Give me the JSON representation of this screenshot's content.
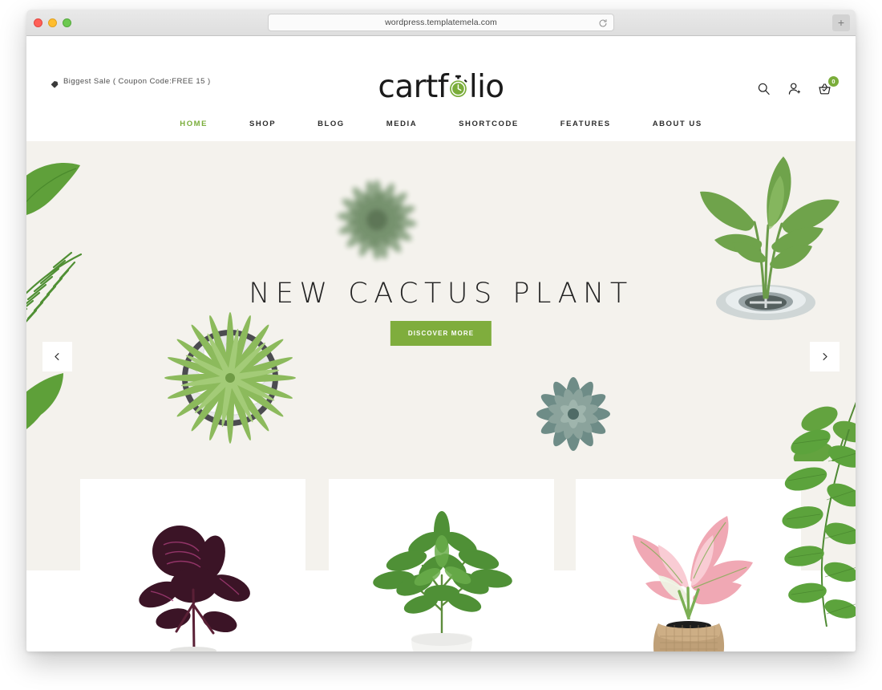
{
  "browser": {
    "url": "wordpress.templatemela.com",
    "reload_icon": "reload-icon",
    "new_tab_label": "+",
    "traffic_lights": [
      "close",
      "minimize",
      "maximize"
    ]
  },
  "header": {
    "promo": {
      "icon": "tag-icon",
      "text": "Biggest Sale ( Coupon Code:FREE 15 )"
    },
    "logo": {
      "text_before": "cartf",
      "mark": "stopwatch-icon",
      "text_after": "lio",
      "full_text": "cartfolio"
    },
    "icons": [
      {
        "name": "search-icon",
        "label": "Search"
      },
      {
        "name": "user-icon",
        "label": "My Account"
      },
      {
        "name": "cart-icon",
        "label": "Cart",
        "badge": "0"
      }
    ],
    "nav": [
      {
        "label": "HOME",
        "active": true
      },
      {
        "label": "SHOP",
        "active": false
      },
      {
        "label": "BLOG",
        "active": false
      },
      {
        "label": "MEDIA",
        "active": false
      },
      {
        "label": "SHORTCODE",
        "active": false
      },
      {
        "label": "FEATURES",
        "active": false
      },
      {
        "label": "ABOUT US",
        "active": false
      }
    ]
  },
  "hero": {
    "title": "NEW CACTUS PLANT",
    "cta_label": "DISCOVER MORE",
    "prev_arrow": "chevron-left-icon",
    "next_arrow": "chevron-right-icon",
    "background_color": "#f4f2ed",
    "decorations": [
      "blurred-agave-plant",
      "spiky-plant-in-stone-pot",
      "blue-grey-succulent",
      "plant-in-metal-drain",
      "leaf-left-edge",
      "fern-left-edge",
      "branch-right-edge"
    ]
  },
  "products": [
    {
      "name": "dark-purple-calathea-in-white-pot"
    },
    {
      "name": "green-schefflera-in-white-pot"
    },
    {
      "name": "pink-aglaonema-in-burlap-sack"
    }
  ],
  "colors": {
    "accent_green": "#7aad3a",
    "cta_green": "#7fad3d",
    "hero_cream": "#f4f2ed",
    "text_dark": "#1e1e1e"
  }
}
